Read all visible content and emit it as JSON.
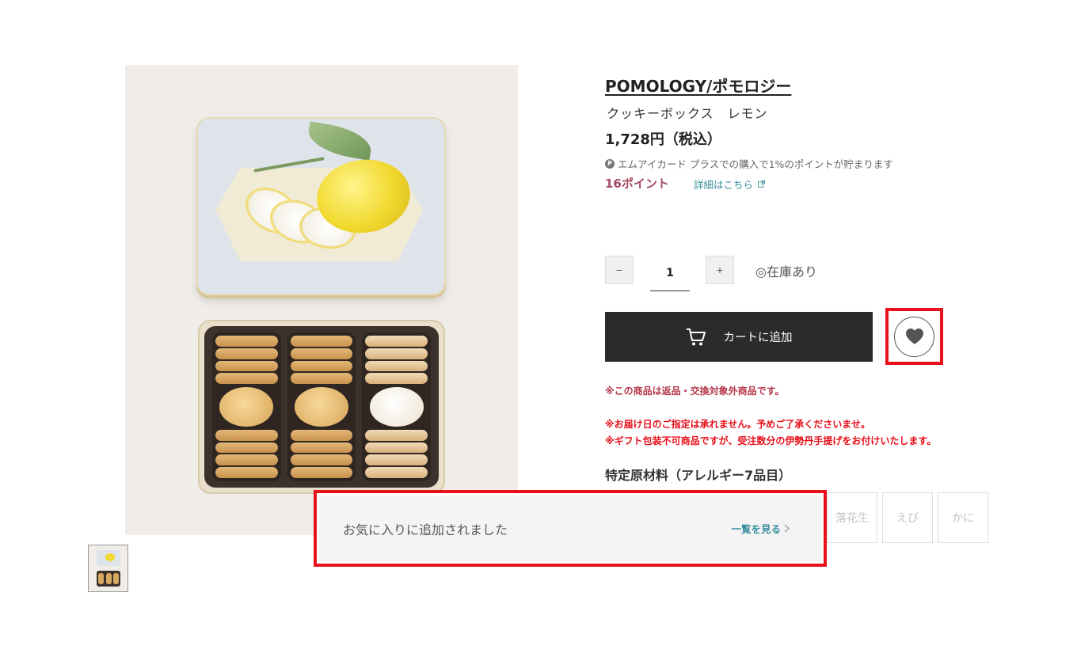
{
  "product": {
    "brand": "POMOLOGY/ポモロジー",
    "name": "クッキーボックス　レモン",
    "price": "1,728円（税込）",
    "points_note": "エムアイカード プラスでの購入で1%のポイントが貯まります",
    "points": "16ポイント",
    "details_link": "詳細はこちら"
  },
  "purchase": {
    "qty_minus": "−",
    "qty_plus": "+",
    "quantity": "1",
    "stock": "◎在庫あり",
    "add_to_cart": "カートに追加"
  },
  "notices": {
    "line1": "※この商品は返品・交換対象外商品です。",
    "line2": "※お届け日のご指定は承れません。予めご了承くださいませ。",
    "line3": "※ギフト包装不可商品ですが、受注数分の伊勢丹手提げをお付けいたします。"
  },
  "allergy": {
    "title": "特定原材料（アレルギー7品目）",
    "items": [
      "落花生",
      "えび",
      "かに"
    ]
  },
  "toast": {
    "message": "お気に入りに追加されました",
    "link": "一覧を見る"
  },
  "icons": {
    "points": "point-p-icon",
    "external": "external-link-icon",
    "cart": "cart-icon",
    "favorite": "heart-icon",
    "chevron": "chevron-right-icon"
  },
  "colors": {
    "cart_button": "#2b2b2b",
    "points": "#a3485f",
    "link": "#3a8f9e",
    "warning": "#e8101a",
    "notice": "#b5394b",
    "highlight": "#e8101a"
  }
}
